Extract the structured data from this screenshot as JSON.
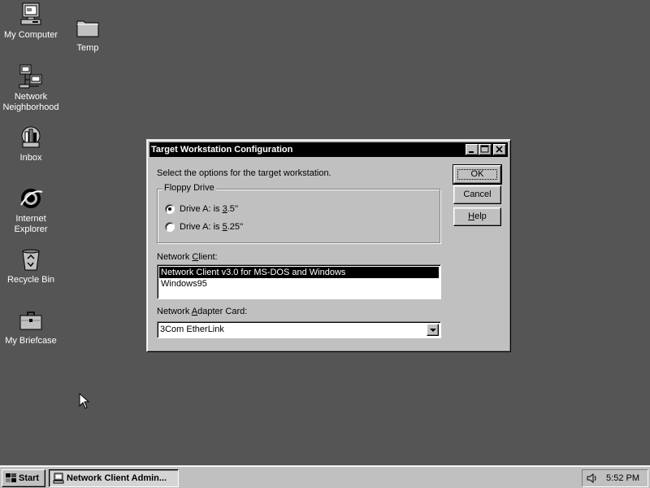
{
  "desktop": {
    "icons": [
      {
        "name": "my-computer",
        "label": "My Computer"
      },
      {
        "name": "temp",
        "label": "Temp"
      },
      {
        "name": "network-neighborhood",
        "label_line1": "Network",
        "label_line2": "Neighborhood"
      },
      {
        "name": "inbox",
        "label": "Inbox"
      },
      {
        "name": "internet-explorer",
        "label_line1": "Internet",
        "label_line2": "Explorer"
      },
      {
        "name": "recycle-bin",
        "label": "Recycle Bin"
      },
      {
        "name": "my-briefcase",
        "label": "My Briefcase"
      }
    ]
  },
  "dialog": {
    "title": "Target Workstation Configuration",
    "instructions": "Select the options for the target workstation.",
    "floppy_group_label": "Floppy Drive",
    "floppy_options": [
      {
        "label_pre": "Drive A: is ",
        "label_mnemonic": "3",
        "label_post": ".5''",
        "checked": true
      },
      {
        "label_pre": "Drive A: is ",
        "label_mnemonic": "5",
        "label_post": ".25''",
        "checked": false
      }
    ],
    "network_client_label_pre": "Network ",
    "network_client_label_mnemonic": "C",
    "network_client_label_post": "lient:",
    "network_client_items": [
      {
        "label": "Network Client v3.0 for MS-DOS and Windows",
        "selected": true
      },
      {
        "label": "Windows95",
        "selected": false
      }
    ],
    "adapter_label_pre": "Network ",
    "adapter_label_mnemonic": "A",
    "adapter_label_post": "dapter Card:",
    "adapter_value": "3Com EtherLink",
    "buttons": {
      "ok": "OK",
      "cancel": "Cancel",
      "help_mnemonic": "H",
      "help_rest": "elp"
    }
  },
  "taskbar": {
    "start_label": "Start",
    "task_label": "Network Client Admin...",
    "clock": "5:52 PM"
  },
  "colors": {
    "desktop": "#555555",
    "face": "#c0c0c0",
    "titlebar": "#000000",
    "selection": "#000000"
  }
}
